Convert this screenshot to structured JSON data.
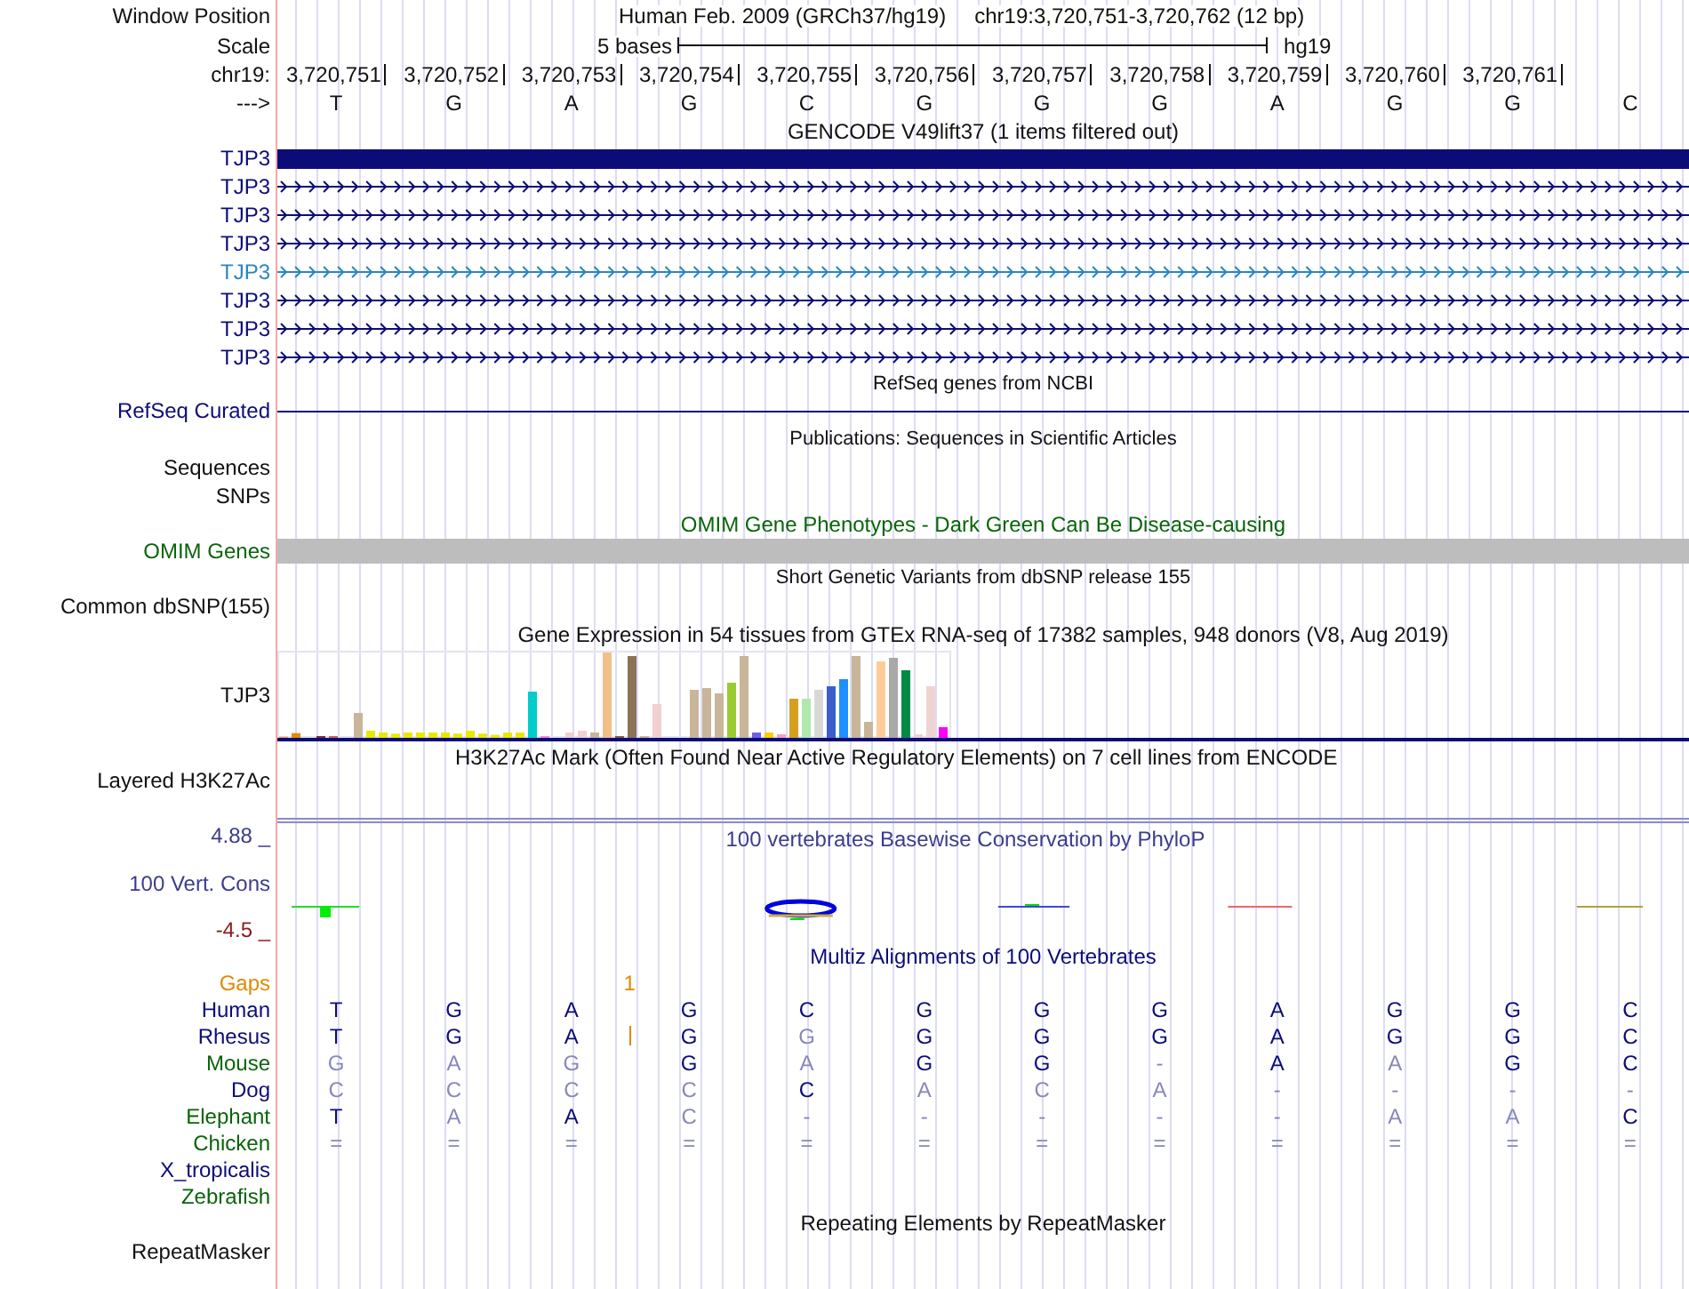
{
  "header": {
    "window_label": "Window Position",
    "assembly": "Human Feb. 2009 (GRCh37/hg19)",
    "position": "chr19:3,720,751-3,720,762 (12 bp)"
  },
  "scale": {
    "label": "Scale",
    "span": "5 bases",
    "assembly": "hg19"
  },
  "coordinates": {
    "label": "chr19:",
    "positions": [
      "3,720,751",
      "3,720,752",
      "3,720,753",
      "3,720,754",
      "3,720,755",
      "3,720,756",
      "3,720,757",
      "3,720,758",
      "3,720,759",
      "3,720,760",
      "3,720,761"
    ]
  },
  "sequence": {
    "label": "--->",
    "bases": [
      "T",
      "G",
      "A",
      "G",
      "C",
      "G",
      "G",
      "G",
      "A",
      "G",
      "G",
      "C"
    ]
  },
  "gencode": {
    "title": "GENCODE V49lift37 (1 items filtered out)",
    "transcripts": [
      {
        "label": "TJP3",
        "kind": "exon",
        "color": "#0c0c78"
      },
      {
        "label": "TJP3",
        "kind": "intron",
        "color": "#0c0c78"
      },
      {
        "label": "TJP3",
        "kind": "intron",
        "color": "#0c0c78"
      },
      {
        "label": "TJP3",
        "kind": "intron",
        "color": "#0c0c78"
      },
      {
        "label": "TJP3",
        "kind": "intron",
        "color": "#2a86c0"
      },
      {
        "label": "TJP3",
        "kind": "intron",
        "color": "#0c0c78"
      },
      {
        "label": "TJP3",
        "kind": "intron",
        "color": "#0c0c78"
      },
      {
        "label": "TJP3",
        "kind": "intron",
        "color": "#0c0c78"
      }
    ]
  },
  "refseq": {
    "title": "RefSeq genes from NCBI",
    "label": "RefSeq Curated"
  },
  "publications": {
    "title": "Publications: Sequences in Scientific Articles",
    "labels": [
      "Sequences",
      "SNPs"
    ]
  },
  "omim": {
    "title": "OMIM Gene Phenotypes - Dark Green Can Be Disease-causing",
    "label": "OMIM Genes"
  },
  "dbsnp": {
    "title": "Short Genetic Variants from dbSNP release 155",
    "label": "Common dbSNP(155)"
  },
  "gtex": {
    "title": "Gene Expression in 54 tissues from GTEx RNA-seq of 17382 samples, 948 donors (V8, Aug 2019)",
    "label": "TJP3"
  },
  "h3k27ac": {
    "title": "H3K27Ac Mark (Often Found Near Active Regulatory Elements) on 7 cell lines from ENCODE",
    "label": "Layered H3K27Ac"
  },
  "phylop": {
    "title": "100 vertebrates Basewise Conservation by PhyloP",
    "label": "100 Vert. Cons",
    "max": "4.88 _",
    "min": "-4.5 _"
  },
  "multiz": {
    "title": "Multiz Alignments of 100 Vertebrates",
    "gaps": {
      "label": "Gaps",
      "count": "1"
    },
    "species": [
      {
        "name": "Human",
        "color": "#0c0c78",
        "bases": [
          {
            "base": "T",
            "match": true,
            "insertion": false
          },
          {
            "base": "G",
            "match": true,
            "insertion": false
          },
          {
            "base": "A",
            "match": true,
            "insertion": false
          },
          {
            "base": "G",
            "match": true,
            "insertion": false
          },
          {
            "base": "C",
            "match": true,
            "insertion": false
          },
          {
            "base": "G",
            "match": true,
            "insertion": false
          },
          {
            "base": "G",
            "match": true,
            "insertion": false
          },
          {
            "base": "G",
            "match": true,
            "insertion": false
          },
          {
            "base": "A",
            "match": true,
            "insertion": false
          },
          {
            "base": "G",
            "match": true,
            "insertion": false
          },
          {
            "base": "G",
            "match": true,
            "insertion": false
          },
          {
            "base": "C",
            "match": true,
            "insertion": false
          }
        ]
      },
      {
        "name": "Rhesus",
        "color": "#0c0c78",
        "bases": [
          {
            "base": "T",
            "match": true,
            "insertion": false
          },
          {
            "base": "G",
            "match": true,
            "insertion": false
          },
          {
            "base": "A",
            "match": true,
            "insertion": true
          },
          {
            "base": "G",
            "match": true,
            "insertion": false
          },
          {
            "base": "G",
            "match": false,
            "insertion": false
          },
          {
            "base": "G",
            "match": true,
            "insertion": false
          },
          {
            "base": "G",
            "match": true,
            "insertion": false
          },
          {
            "base": "G",
            "match": true,
            "insertion": false
          },
          {
            "base": "A",
            "match": true,
            "insertion": false
          },
          {
            "base": "G",
            "match": true,
            "insertion": false
          },
          {
            "base": "G",
            "match": true,
            "insertion": false
          },
          {
            "base": "C",
            "match": true,
            "insertion": false
          }
        ]
      },
      {
        "name": "Mouse",
        "color": "#0a640a",
        "bases": [
          {
            "base": "G",
            "match": false,
            "insertion": false
          },
          {
            "base": "A",
            "match": false,
            "insertion": false
          },
          {
            "base": "G",
            "match": false,
            "insertion": false
          },
          {
            "base": "G",
            "match": true,
            "insertion": false
          },
          {
            "base": "A",
            "match": false,
            "insertion": false
          },
          {
            "base": "G",
            "match": true,
            "insertion": false
          },
          {
            "base": "G",
            "match": true,
            "insertion": false
          },
          {
            "base": "-",
            "match": false,
            "insertion": false
          },
          {
            "base": "A",
            "match": true,
            "insertion": false
          },
          {
            "base": "A",
            "match": false,
            "insertion": false
          },
          {
            "base": "G",
            "match": true,
            "insertion": false
          },
          {
            "base": "C",
            "match": true,
            "insertion": false
          }
        ]
      },
      {
        "name": "Dog",
        "color": "#0c0c78",
        "bases": [
          {
            "base": "C",
            "match": false,
            "insertion": false
          },
          {
            "base": "C",
            "match": false,
            "insertion": false
          },
          {
            "base": "C",
            "match": false,
            "insertion": false
          },
          {
            "base": "C",
            "match": false,
            "insertion": false
          },
          {
            "base": "C",
            "match": true,
            "insertion": false
          },
          {
            "base": "A",
            "match": false,
            "insertion": false
          },
          {
            "base": "C",
            "match": false,
            "insertion": false
          },
          {
            "base": "A",
            "match": false,
            "insertion": false
          },
          {
            "base": "-",
            "match": false,
            "insertion": false
          },
          {
            "base": "-",
            "match": false,
            "insertion": false
          },
          {
            "base": "-",
            "match": false,
            "insertion": false
          },
          {
            "base": "-",
            "match": false,
            "insertion": false
          }
        ]
      },
      {
        "name": "Elephant",
        "color": "#0a640a",
        "bases": [
          {
            "base": "T",
            "match": true,
            "insertion": false
          },
          {
            "base": "A",
            "match": false,
            "insertion": false
          },
          {
            "base": "A",
            "match": true,
            "insertion": false
          },
          {
            "base": "C",
            "match": false,
            "insertion": false
          },
          {
            "base": "-",
            "match": false,
            "insertion": false
          },
          {
            "base": "-",
            "match": false,
            "insertion": false
          },
          {
            "base": "-",
            "match": false,
            "insertion": false
          },
          {
            "base": "-",
            "match": false,
            "insertion": false
          },
          {
            "base": "-",
            "match": false,
            "insertion": false
          },
          {
            "base": "A",
            "match": false,
            "insertion": false
          },
          {
            "base": "A",
            "match": false,
            "insertion": false
          },
          {
            "base": "C",
            "match": true,
            "insertion": false
          }
        ]
      },
      {
        "name": "Chicken",
        "color": "#0a640a",
        "bases": [
          {
            "base": "=",
            "match": false,
            "insertion": false
          },
          {
            "base": "=",
            "match": false,
            "insertion": false
          },
          {
            "base": "=",
            "match": false,
            "insertion": false
          },
          {
            "base": "=",
            "match": false,
            "insertion": false
          },
          {
            "base": "=",
            "match": false,
            "insertion": false
          },
          {
            "base": "=",
            "match": false,
            "insertion": false
          },
          {
            "base": "=",
            "match": false,
            "insertion": false
          },
          {
            "base": "=",
            "match": false,
            "insertion": false
          },
          {
            "base": "=",
            "match": false,
            "insertion": false
          },
          {
            "base": "=",
            "match": false,
            "insertion": false
          },
          {
            "base": "=",
            "match": false,
            "insertion": false
          },
          {
            "base": "=",
            "match": false,
            "insertion": false
          }
        ]
      },
      {
        "name": "X_tropicalis",
        "color": "#0c0c78"
      },
      {
        "name": "Zebrafish",
        "color": "#0a640a"
      }
    ]
  },
  "repeatmasker": {
    "title": "Repeating Elements by RepeatMasker",
    "label": "RepeatMasker"
  }
}
